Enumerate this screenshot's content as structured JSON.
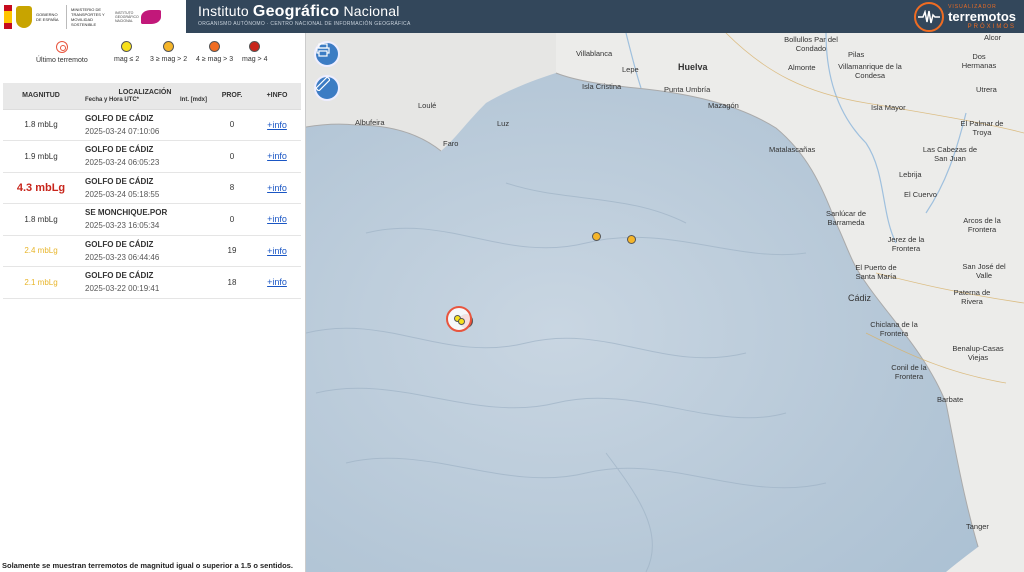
{
  "header": {
    "gov": {
      "gobierno": "GOBIERNO DE ESPAÑA",
      "ministerio": "MINISTERIO DE TRANSPORTES Y MOVILIDAD SOSTENIBLE",
      "instituto": "INSTITUTO GEOGRÁFICO NACIONAL"
    },
    "title_pre": "Instituto ",
    "title_bold": "Geográfico",
    "title_post": " Nacional",
    "subtitle": "ORGANISMO AUTÓNOMO · CENTRO NACIONAL DE INFORMACIÓN GEOGRÁFICA",
    "brand_small": "VISUALIZADOR",
    "brand_main": "terremotos",
    "brand_sub": "PRÓXIMOS"
  },
  "legend": {
    "last": "Último terremoto",
    "items": [
      {
        "label": "mag ≤ 2",
        "color": "#f7e01b"
      },
      {
        "label": "3 ≥ mag > 2",
        "color": "#f5b52a"
      },
      {
        "label": "4 ≥ mag > 3",
        "color": "#ef6c22"
      },
      {
        "label": "mag > 4",
        "color": "#c8251b"
      }
    ]
  },
  "table": {
    "headers": {
      "magnitud": "MAGNITUD",
      "localizacion": "LOCALIZACIÓN",
      "fecha": "Fecha y Hora UTC*",
      "intensidad": "Int. [mdx]",
      "prof": "PROF.",
      "info": "+INFO"
    },
    "rows": [
      {
        "mag": "1.8 mbLg",
        "style": "normal",
        "place": "GOLFO DE CÁDIZ",
        "date": "2025-03-24 07:10:06",
        "prof": "0",
        "info": "+info"
      },
      {
        "mag": "1.9 mbLg",
        "style": "normal",
        "place": "GOLFO DE CÁDIZ",
        "date": "2025-03-24 06:05:23",
        "prof": "0",
        "info": "+info"
      },
      {
        "mag": "4.3 mbLg",
        "style": "red",
        "place": "GOLFO DE CÁDIZ",
        "date": "2025-03-24 05:18:55",
        "prof": "8",
        "info": "+info"
      },
      {
        "mag": "1.8 mbLg",
        "style": "normal",
        "place": "SE MONCHIQUE.POR",
        "date": "2025-03-23 16:05:34",
        "prof": "0",
        "info": "+info"
      },
      {
        "mag": "2.4 mbLg",
        "style": "yellow",
        "place": "GOLFO DE CÁDIZ",
        "date": "2025-03-23 06:44:46",
        "prof": "19",
        "info": "+info"
      },
      {
        "mag": "2.1 mbLg",
        "style": "yellow",
        "place": "GOLFO DE CÁDIZ",
        "date": "2025-03-22 00:19:41",
        "prof": "18",
        "info": "+info"
      }
    ]
  },
  "note": "Solamente se muestran terremotos de magnitud igual o superior a 1.5 o sentidos.",
  "map": {
    "print_icon": "print-icon",
    "measure_icon": "ruler-icon",
    "labels": [
      "Villablanca",
      "Lepe",
      "Huelva",
      "Isla Cristina",
      "Punta Umbría",
      "Mazagón",
      "Bollullos Par del Condado",
      "Almonte",
      "Pilas",
      "Villamanrique de la Condesa",
      "Dos Hermanas",
      "Alcor",
      "Utrera",
      "Isla Mayor",
      "El Palmar de Troya",
      "Las Cabezas de San Juan",
      "Matalascañas",
      "Lebrija",
      "El Cuervo",
      "Sanlúcar de Barrameda",
      "Arcos de la Frontera",
      "Jerez de la Frontera",
      "El Puerto de Santa María",
      "San José del Valle",
      "Paterna de Rivera",
      "Cádiz",
      "Chiclana de la Frontera",
      "Benalup-Casas Viejas",
      "Conil de la Frontera",
      "Barbate",
      "Tanger",
      "Loulé",
      "Albufeira",
      "Luz",
      "Faro"
    ]
  }
}
